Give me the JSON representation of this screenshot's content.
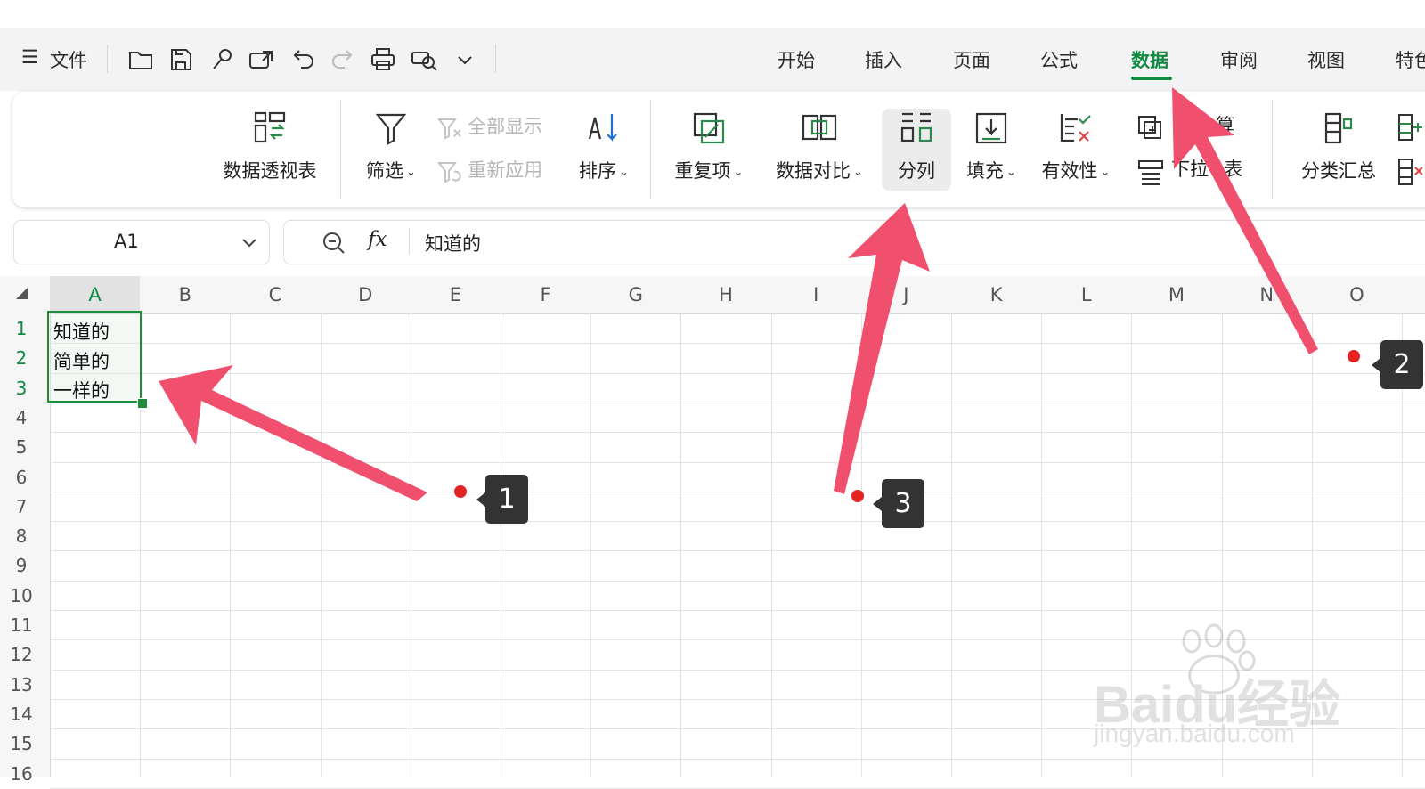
{
  "menu": {
    "hamburger": "☰",
    "file": "文件"
  },
  "tabs": [
    {
      "label": "开始"
    },
    {
      "label": "插入"
    },
    {
      "label": "页面"
    },
    {
      "label": "公式"
    },
    {
      "label": "数据",
      "active": true
    },
    {
      "label": "审阅"
    },
    {
      "label": "视图"
    },
    {
      "label": "特色"
    }
  ],
  "ribbon": {
    "pivot": "数据透视表",
    "filter": "筛选",
    "show_all": "全部显示",
    "reapply": "重新应用",
    "sort": "排序",
    "duplicates": "重复项",
    "compare": "数据对比",
    "split": "分列",
    "fill": "填充",
    "validity": "有效性",
    "calc_partial": "算",
    "dropdown_partial1": "下拉",
    "dropdown_partial2": "表",
    "subtotal": "分类汇总"
  },
  "formula_bar": {
    "cell_ref": "A1",
    "fx": "fx",
    "content": "知道的"
  },
  "grid": {
    "columns": [
      "A",
      "B",
      "C",
      "D",
      "E",
      "F",
      "G",
      "H",
      "I",
      "J",
      "K",
      "L",
      "M",
      "N",
      "O"
    ],
    "rows": [
      "1",
      "2",
      "3",
      "4",
      "5",
      "6",
      "7",
      "8",
      "9",
      "10",
      "11",
      "12",
      "13",
      "14",
      "15",
      "16"
    ],
    "cells": [
      {
        "ref": "A1",
        "value": "知道的"
      },
      {
        "ref": "A2",
        "value": "简单的"
      },
      {
        "ref": "A3",
        "value": "一样的"
      }
    ]
  },
  "annotations": [
    {
      "number": "1"
    },
    {
      "number": "2"
    },
    {
      "number": "3"
    }
  ],
  "watermark": {
    "brand": "Baidu经验",
    "url": "jingyan.baidu.com"
  },
  "colors": {
    "accent": "#0e8a43",
    "arrow": "#f0506e",
    "marker": "#e52222",
    "badge": "#333333"
  }
}
